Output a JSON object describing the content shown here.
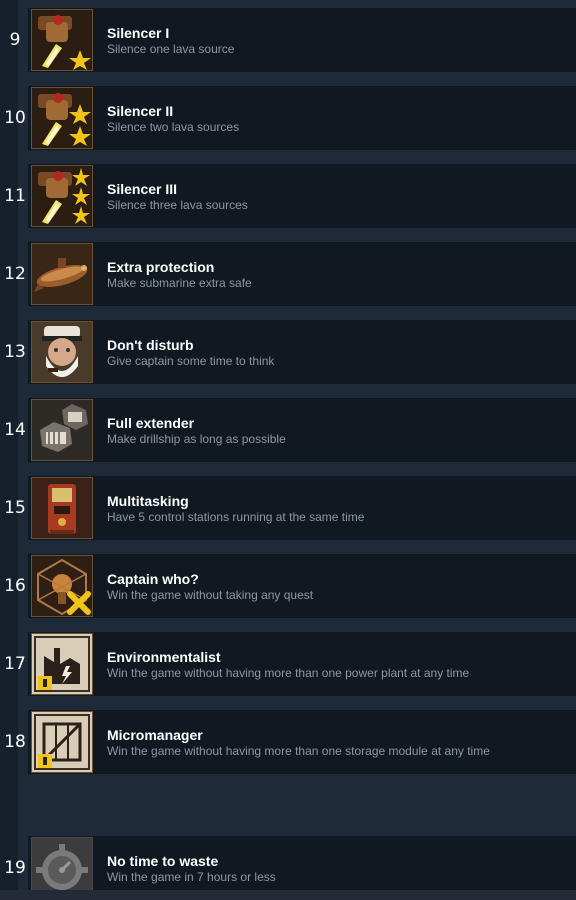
{
  "achievements": [
    {
      "number": "9",
      "title": "Silencer I",
      "description": "Silence one lava source",
      "icon": "lava-drill-one-star-icon",
      "stars": 1
    },
    {
      "number": "10",
      "title": "Silencer II",
      "description": "Silence two lava sources",
      "icon": "lava-drill-two-star-icon",
      "stars": 2
    },
    {
      "number": "11",
      "title": "Silencer III",
      "description": "Silence three lava sources",
      "icon": "lava-drill-three-star-icon",
      "stars": 3
    },
    {
      "number": "12",
      "title": "Extra protection",
      "description": "Make submarine extra safe",
      "icon": "submarine-icon"
    },
    {
      "number": "13",
      "title": "Don't disturb",
      "description": "Give captain some time to think",
      "icon": "captain-portrait-icon"
    },
    {
      "number": "14",
      "title": "Full extender",
      "description": "Make drillship as long as possible",
      "icon": "drillship-modules-icon"
    },
    {
      "number": "15",
      "title": "Multitasking",
      "description": "Have 5 control stations running at the same time",
      "icon": "control-station-icon"
    },
    {
      "number": "16",
      "title": "Captain who?",
      "description": "Win the game without taking any quest",
      "icon": "quest-cancel-icon"
    },
    {
      "number": "17",
      "title": "Environmentalist",
      "description": "Win the game without having more than one power plant at any time",
      "icon": "power-plant-icon"
    },
    {
      "number": "18",
      "title": "Micromanager",
      "description": "Win the game without having more than one storage module at any time",
      "icon": "storage-module-icon"
    },
    {
      "number": "19",
      "title": "No time to waste",
      "description": "Win the game in 7 hours or less",
      "icon": "gear-clock-icon"
    }
  ],
  "colors": {
    "page_background": "#1b2838",
    "card_background": "#101822",
    "title_text": "#ffffff",
    "description_text": "#8f98a0",
    "icon_border": "#6b5133",
    "star": "#f0c419"
  }
}
